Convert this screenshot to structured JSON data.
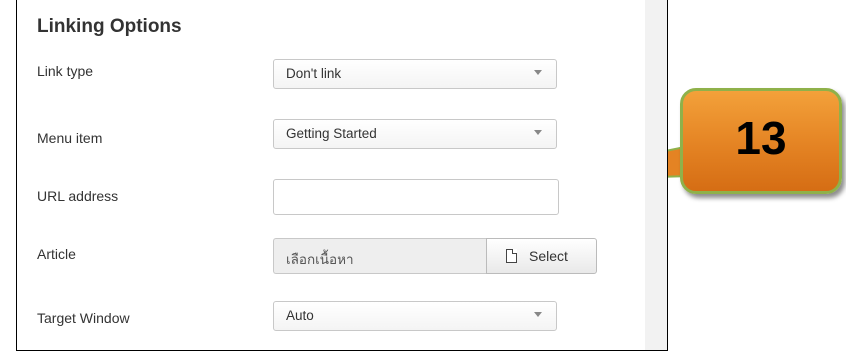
{
  "section": {
    "title": "Linking Options"
  },
  "fields": {
    "link_type": {
      "label": "Link type",
      "value": "Don't link"
    },
    "menu_item": {
      "label": "Menu item",
      "value": "Getting Started"
    },
    "url_address": {
      "label": "URL address",
      "value": ""
    },
    "article": {
      "label": "Article",
      "value": "เลือกเนื้อหา",
      "button_label": "Select",
      "button_icon": "file-icon"
    },
    "target_window": {
      "label": "Target Window",
      "value": "Auto"
    }
  },
  "callout": {
    "number": "13",
    "colors": {
      "fill": "#e48323",
      "border": "#8fb14a"
    }
  }
}
